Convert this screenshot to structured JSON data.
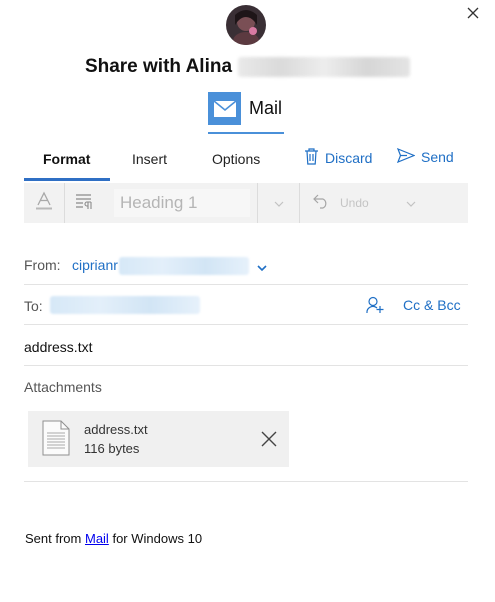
{
  "dialog": {
    "title_prefix": "Share with Alina",
    "app_name": "Mail"
  },
  "tabs": [
    {
      "label": "Format",
      "active": true
    },
    {
      "label": "Insert",
      "active": false
    },
    {
      "label": "Options",
      "active": false
    }
  ],
  "actions": {
    "discard_label": "Discard",
    "send_label": "Send"
  },
  "toolbar": {
    "style_value": "Heading 1",
    "undo_label": "Undo"
  },
  "from": {
    "label": "From:",
    "account_prefix": "ciprianr"
  },
  "to": {
    "label": "To:",
    "cc_bcc_label": "Cc & Bcc"
  },
  "subject": "address.txt",
  "attachments": {
    "label": "Attachments",
    "items": [
      {
        "name": "address.txt",
        "size": "116 bytes"
      }
    ]
  },
  "signature": {
    "prefix": "Sent from",
    "link": "Mail",
    "suffix": "for Windows 10"
  },
  "colors": {
    "accent": "#1f6fc5",
    "mail_tile": "#4a90d9",
    "toolbar_bg": "#f2f2f2"
  }
}
